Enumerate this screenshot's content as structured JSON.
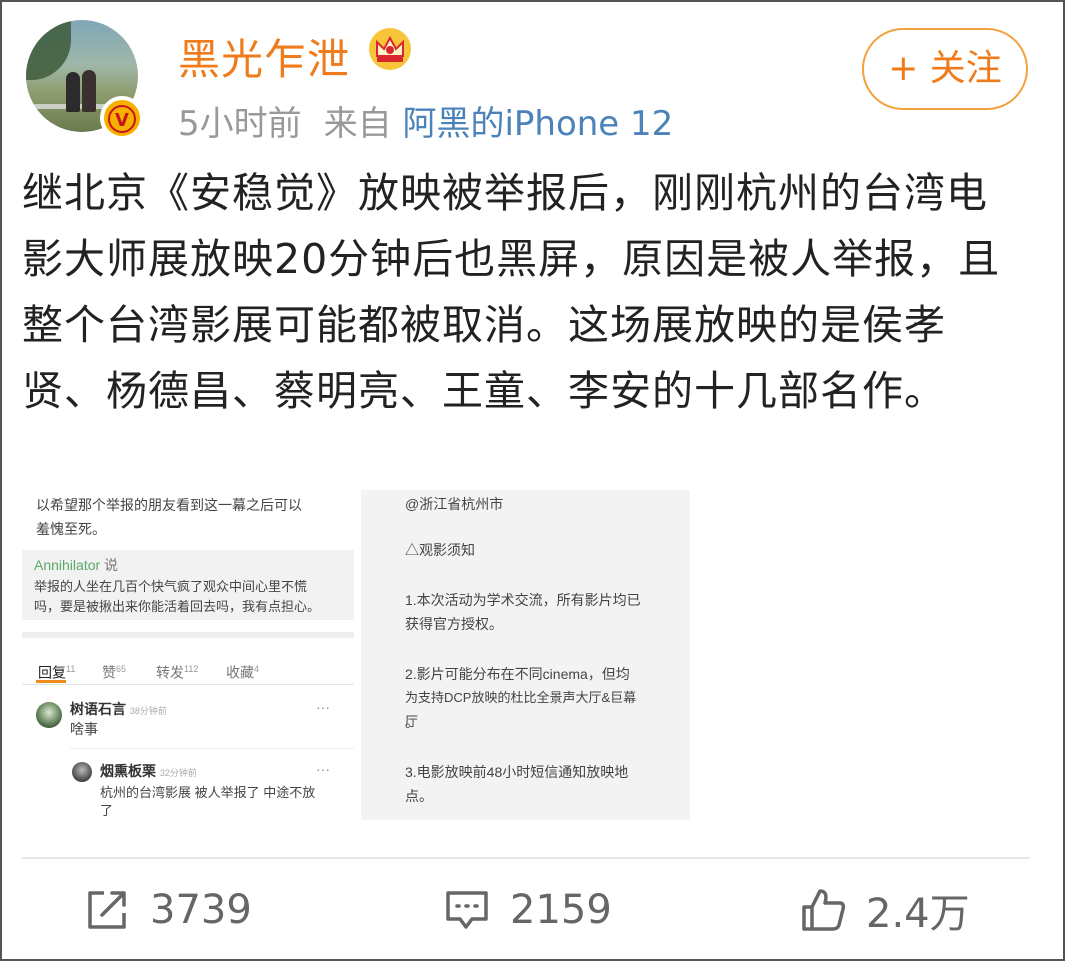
{
  "post": {
    "username": "黑光乍泄",
    "time": "5小时前",
    "from_label": "来自",
    "source": "阿黑的iPhone 12",
    "follow_label": "+ 关注",
    "content": "继北京《安稳觉》放映被举报后，刚刚杭州的台湾电影大师展放映20分钟后也黑屏，原因是被人举报，且整个台湾影展可能都被取消。这场展放映的是侯孝贤、杨德昌、蔡明亮、王童、李安的十几部名作。"
  },
  "image1": {
    "top_text_1": "以希望那个举报的朋友看到这一幕之后可以",
    "top_text_2": "羞愧至死。",
    "quote_author": "Annihilator",
    "quote_says": "说",
    "quote_line_1": "举报的人坐在几百个快气疯了观众中间心里不慌",
    "quote_line_2": "吗，要是被揪出来你能活着回去吗，我有点担心。",
    "tabs": [
      {
        "label": "回复",
        "count": "11"
      },
      {
        "label": "赞",
        "count": "65"
      },
      {
        "label": "转发",
        "count": "112"
      },
      {
        "label": "收藏",
        "count": "4"
      }
    ],
    "comments": [
      {
        "name": "树语石言",
        "time": "38分钟前",
        "text": "啥事",
        "more": "···"
      },
      {
        "name": "烟熏板栗",
        "time": "32分钟前",
        "text_1": "杭州的台湾影展 被人举报了 中途不放",
        "text_2": "了",
        "more": "···"
      }
    ]
  },
  "image2": {
    "location": "@浙江省杭州市",
    "heading": "△观影须知",
    "item1_a": "1.本次活动为学术交流，所有影片均已",
    "item1_b": "获得官方授权。",
    "item2_a": "2.影片可能分布在不同cinema，但均",
    "item2_b": "为支持DCP放映的杜比全景声大厅&巨幕厅",
    "item2_c": "。",
    "item3_a": "3.电影放映前48小时短信通知放映地",
    "item3_b": "点。"
  },
  "actions": {
    "repost_count": "3739",
    "comment_count": "2159",
    "like_count": "2.4万"
  },
  "colors": {
    "username": "#ef7b1a",
    "source_link": "#4b82b8",
    "follow_border": "#f2a23c"
  }
}
